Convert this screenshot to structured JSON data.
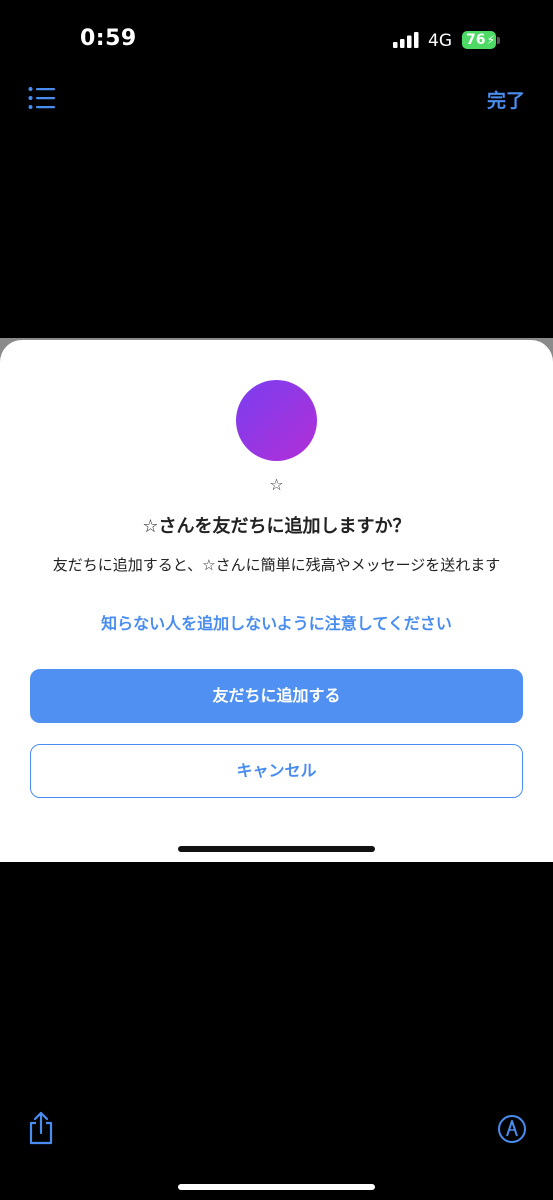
{
  "status_bar": {
    "time": "0:59",
    "network": "4G",
    "battery": "76"
  },
  "toolbar": {
    "list_icon": "list-icon",
    "done_label": "完了"
  },
  "dialog": {
    "avatar_color_start": "#7a3ef0",
    "avatar_color_end": "#b22fd6",
    "name": "☆",
    "title": "☆さんを友だちに追加しますか？",
    "description": "友だちに追加すると、☆さんに簡単に残高やメッセージを送れます",
    "warning": "知らない人を追加しないように注意してください",
    "add_label": "友だちに追加する",
    "cancel_label": "キャンセル"
  },
  "bottom_toolbar": {
    "share_icon": "share-icon",
    "markup_icon": "markup-icon"
  },
  "colors": {
    "accent": "#4a8df0",
    "primary_button": "#4f90f2",
    "background": "#000000",
    "battery": "#4cd964"
  }
}
